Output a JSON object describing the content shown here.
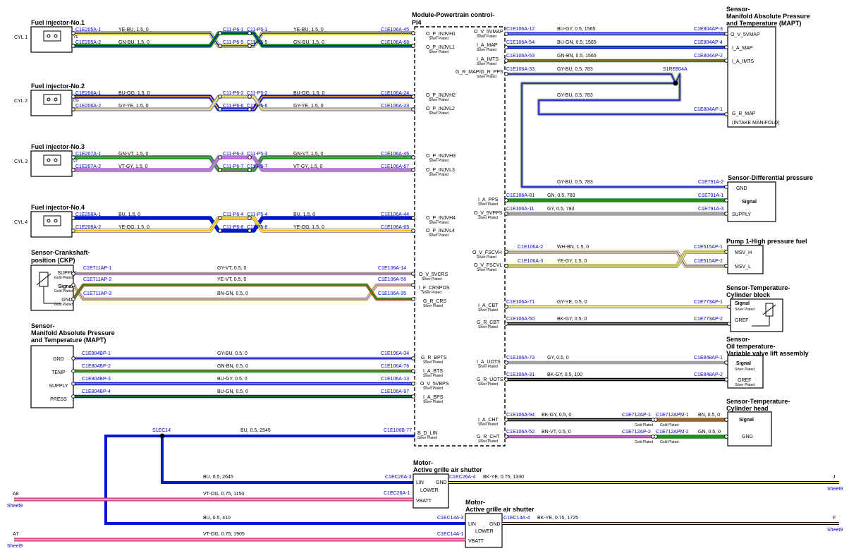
{
  "module": {
    "title_line1": "Module-Powertrain control-",
    "title_line2": "PI4",
    "silver": "Silver Plated",
    "gold": "Gold Plated",
    "left_pins": [
      "O_P_INJVH1",
      "O_P_INJVL1",
      "O_P_INJVH2",
      "O_P_INJVL2",
      "O_P_INJVH3",
      "O_P_INJVL3",
      "O_P_INJVH4",
      "O_P_INJVL4",
      "O_V_5VCRS",
      "I_F_CRSPOS",
      "G_R_CRS",
      "G_R_BPTS",
      "I_A_BTS",
      "O_V_5VBPS",
      "I_A_BPS",
      "B_D_LIN"
    ],
    "right_pins": [
      "O_V_5VMAP",
      "I_A_MAP",
      "I_A_IMTS",
      "G_R_MAP/G_R_PPS",
      "I_A_PPS",
      "O_V_5VPPS",
      "O_V_FSCVH",
      "O_V_FSCVL",
      "I_A_CBT",
      "G_R_CBT",
      "I_A_UOTS",
      "G_R_UOTS",
      "I_A_CHT",
      "G_R_CHT"
    ]
  },
  "injectors": [
    {
      "title": "Fuel injector-No.1",
      "cyl": "CYL 1",
      "c1": "C1E205A-1",
      "c2": "C1E205A-2",
      "w1": "YE-BU, 1.5, 0",
      "w2": "GN-BU, 1.5, 0",
      "m1": "C11-P6-1",
      "m1b": "C11-P5-1",
      "m2": "C11-P6-5",
      "m2b": "C11-P5-5",
      "e1": "C1E106A-45",
      "e2": "C1E106A-68",
      "pinA": "YE",
      "pinB": "YE"
    },
    {
      "title": "Fuel injector-No.2",
      "cyl": "CYL 2",
      "c1": "C1E206A-1",
      "c2": "C1E206A-2",
      "w1": "BU-OG, 1.5, 0",
      "w2": "GY-YE, 1.5, 0",
      "m1": "C11-P6-2",
      "m1b": "C11-P5-2",
      "m2": "C11-P6-6",
      "m2b": "C11-P5-6",
      "e1": "C1E106A-24",
      "e2": "C1E106A-23",
      "pinA": "OG",
      "pinB": "YE"
    },
    {
      "title": "Fuel injector-No.3",
      "cyl": "CYL 3",
      "c1": "C1E207A-1",
      "c2": "C1E207A-2",
      "w1": "GN-VT, 1.5, 0",
      "w2": "VT-GY, 1.5, 0",
      "m1": "C11-P6-3",
      "m1b": "C11-P5-3",
      "m2": "C11-P6-7",
      "m2b": "C11-P5-7",
      "e1": "C1E106A-46",
      "e2": "C1E106A-67",
      "pinA": "VT",
      "pinB": "GY"
    },
    {
      "title": "Fuel injector-No.4",
      "cyl": "CYL 4",
      "c1": "C1E208A-1",
      "c2": "C1E208A-2",
      "w1": "BU, 1.5, 0",
      "w2": "YE-OG, 1.5, 0",
      "m1": "C11-P6-4",
      "m1b": "C11-P5-4",
      "m2": "C11-P6-8",
      "m2b": "C11-P5-8",
      "e1": "C1E106A-44",
      "e2": "C1E106A-65",
      "pinA": "",
      "pinB": ""
    }
  ],
  "ckp": {
    "title1": "Sensor-Crankshaft-",
    "title2": "position (CKP)",
    "pins": [
      "SUPPLY",
      "Signal",
      "GND"
    ],
    "wires": [
      {
        "c": "C1E711AP-1",
        "w": "GY-VT, 0.5, 0",
        "e": "C1E106A-14"
      },
      {
        "c": "C1E711AP-2",
        "w": "YE-VT, 0.5, 0",
        "e": "C1E106A-56"
      },
      {
        "c": "C1E711AP-3",
        "w": "BN-GN, 0.5, 0",
        "e": "C1E106A-35"
      }
    ]
  },
  "mapt_left": {
    "title1": "Sensor-",
    "title2": "Manifold Absolute Pressure",
    "title3": "and Temperature (MAPT)",
    "pins": [
      "GND",
      "TEMP",
      "SUPPLY",
      "PRESS"
    ],
    "wires": [
      {
        "c": "C1E804BP-1",
        "w": "GY-BU, 0.5, 0",
        "e": "C1E106A-34"
      },
      {
        "c": "C1E804BP-2",
        "w": "GN-BN, 0.5, 0",
        "e": "C1E106A-76"
      },
      {
        "c": "C1E804BP-3",
        "w": "BU-GY, 0.5, 0",
        "e": "C1E106A-13"
      },
      {
        "c": "C1E804BP-4",
        "w": "BU-GN, 0.5, 0",
        "e": "C1E106A-97"
      }
    ]
  },
  "lin": {
    "splice": "S1EC14",
    "w": "BU, 0.5, 2545",
    "e": "C1E106B-77",
    "w_upper": "BU, 0.5, 2645",
    "w_lower": "BU, 0.5, 410"
  },
  "shutter_upper": {
    "title1": "Motor-",
    "title2": "Active grille air shutter",
    "pins": [
      "LIN",
      "GND",
      "LOWER",
      "VBATT"
    ],
    "c_lin": "C1EC26A-3",
    "c_gnd": "C1EC26A-4",
    "c_vbatt": "C1EC26A-1",
    "w_gnd": "BK-YE, 0.75, 1330",
    "w_vbatt": "VT-OG, 0.75, 1150",
    "src": "A8",
    "src_sheet": "Sheet9",
    "dst": "J",
    "dst_sheet": "Sheet9"
  },
  "shutter_lower": {
    "title1": "Motor-",
    "title2": "Active grille air shutter",
    "pins": [
      "LIN",
      "GND",
      "LOWER",
      "VBATT"
    ],
    "c_lin": "C1EC14A-3",
    "c_gnd": "C1EC14A-4",
    "c_vbatt": "C1EC14A-1",
    "w_gnd": "BK-YE, 0.75, 1725",
    "w_vbatt": "VT-OG, 0.75, 1905",
    "src": "A7",
    "src_sheet": "Sheet9",
    "dst": "F",
    "dst_sheet": "Sheet9"
  },
  "mapt_right": {
    "title1": "Sensor-",
    "title2": "Manifold Absolute Pressure",
    "title3": "and Temperature (MAPT)",
    "pins": [
      "O_V_5VMAP",
      "I_A_MAP",
      "I_A_IMTS",
      "G_R_MAP",
      "(INTAKE MANIFOLD)"
    ],
    "splice": "S1RE804A",
    "wires": [
      {
        "c": "C1E106A-12",
        "w": "BU-GY, 0.5, 1565",
        "e": "C1E804AP-3"
      },
      {
        "c": "C1E106A-54",
        "w": "BU-GN, 0.5, 1565",
        "e": "C1E804AP-4"
      },
      {
        "c": "C1E106A-53",
        "w": "GN-BN, 0.5, 1565",
        "e": "C1E804AP-2"
      },
      {
        "c": "C1E106A-33",
        "w": "GY-BU, 0.5, 783",
        "e": ""
      },
      {
        "c": "",
        "w": "GY-BU, 0.5, 783",
        "e": "C1E804AP-1"
      }
    ]
  },
  "diff": {
    "title": "Sensor-Differential pressure",
    "pins": [
      "GND",
      "Signal",
      "SUPPLY"
    ],
    "wires": [
      {
        "c": "",
        "w": "GY-BU, 0.5, 783",
        "e": "C1E791A-2"
      },
      {
        "c": "C1E106A-81",
        "w": "GN, 0.5, 783",
        "e": "C1E791A-1"
      },
      {
        "c": "C1E106A-11",
        "w": "GY, 0.5, 783",
        "e": "C1E791A-3"
      }
    ]
  },
  "pump": {
    "title": "Pump 1-High pressure fuel",
    "pins": [
      "MSV_H",
      "MSV_L"
    ],
    "wires": [
      {
        "c": "C1E106A-2",
        "w": "WH-BN, 1.5, 0",
        "e": "C1E515AP-1"
      },
      {
        "c": "C1E106A-3",
        "w": "YE-GY, 1.5, 0",
        "e": "C1E515AP-2"
      }
    ]
  },
  "cbt": {
    "title1": "Sensor-Temperature-",
    "title2": "Cylinder block",
    "pins": [
      "Signal",
      "GREF"
    ],
    "wires": [
      {
        "c": "C1E106A-71",
        "w": "GY-YE, 0.5, 0",
        "e": "C1E773AP-1"
      },
      {
        "c": "C1E106A-50",
        "w": "BK-GY, 0.5, 0",
        "e": "C1E773AP-2"
      }
    ]
  },
  "uots": {
    "title1": "Sensor-",
    "title2": "Oil temperature-",
    "title3": "Variable valve lift assembly",
    "pins": [
      "Signal",
      "GREF"
    ],
    "wires": [
      {
        "c": "C1E106A-73",
        "w": "GY, 0.5, 0",
        "e": "C1E848AP-1"
      },
      {
        "c": "C1E106A-31",
        "w": "BK-GY, 0.5, 100",
        "e": "C1E848AP-2"
      }
    ]
  },
  "cht": {
    "title1": "Sensor-Temperature-",
    "title2": "Cylinder head",
    "pins": [
      "Signal",
      "GND"
    ],
    "wires": [
      {
        "c": "C1E106A-94",
        "w": "BK-GY, 0.5, 0",
        "m": "C1E712AP-1",
        "m2": "C1E712APM-1",
        "w2": "BN, 0.5, 0"
      },
      {
        "c": "C1E106A-52",
        "w": "BN-VT, 0.5, 0",
        "m": "C1E712AP-2",
        "m2": "C1E712APM-2",
        "w2": "GN, 0.5, 0"
      }
    ]
  }
}
